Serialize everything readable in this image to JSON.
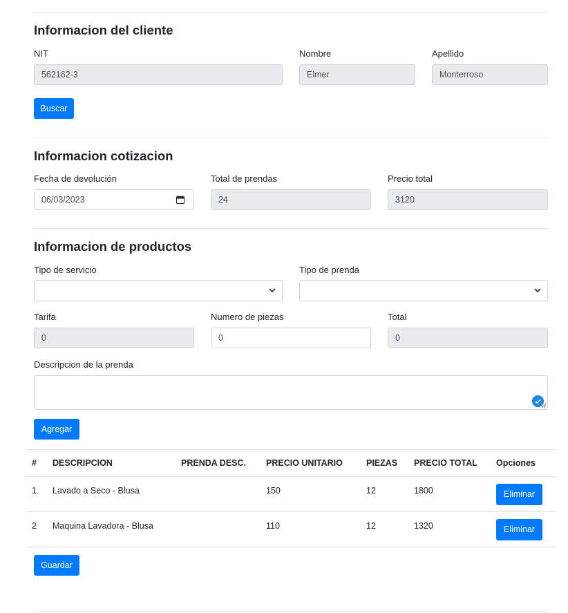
{
  "client_section": {
    "title": "Informacion del cliente",
    "nit_label": "NIT",
    "nit_value": "562162-3",
    "nombre_label": "Nombre",
    "nombre_value": "Elmer",
    "apellido_label": "Apellido",
    "apellido_value": "Monterroso",
    "buscar_label": "Buscar"
  },
  "quote_section": {
    "title": "Informacion cotizacion",
    "fecha_label": "Fecha de devolución",
    "fecha_value": "06/03/2023",
    "total_prendas_label": "Total de prendas",
    "total_prendas_value": "24",
    "precio_total_label": "Precio total",
    "precio_total_value": "3120"
  },
  "product_section": {
    "title": "Informacion de productos",
    "tipo_servicio_label": "Tipo de servicio",
    "tipo_servicio_value": "",
    "tipo_prenda_label": "Tipo de prenda",
    "tipo_prenda_value": "",
    "tarifa_label": "Tarifa",
    "tarifa_value": "0",
    "numero_piezas_label": "Numero de piezas",
    "numero_piezas_value": "0",
    "total_label": "Total",
    "total_value": "0",
    "descripcion_label": "Descripcion de la prenda",
    "descripcion_value": "",
    "agregar_label": "Agregar"
  },
  "table": {
    "headers": [
      "#",
      "DESCRIPCION",
      "PRENDA DESC.",
      "PRECIO UNITARIO",
      "PIEZAS",
      "PRECIO TOTAL",
      "Opciones"
    ],
    "rows": [
      {
        "num": "1",
        "descripcion": "Lavado a Seco - Blusa",
        "prenda_desc": "",
        "precio_unitario": "150",
        "piezas": "12",
        "precio_total": "1800",
        "action": "Eliminar"
      },
      {
        "num": "2",
        "descripcion": "Maquina Lavadora - Blusa",
        "prenda_desc": "",
        "precio_unitario": "110",
        "piezas": "12",
        "precio_total": "1320",
        "action": "Eliminar"
      }
    ]
  },
  "guardar_label": "Guardar",
  "icons": {
    "date": "calendar-icon",
    "select": "chevron-down-icon",
    "check": "check-circle-icon"
  },
  "colors": {
    "primary": "#007bff",
    "readonly_bg": "#e9ecef",
    "border": "#ced4da"
  }
}
